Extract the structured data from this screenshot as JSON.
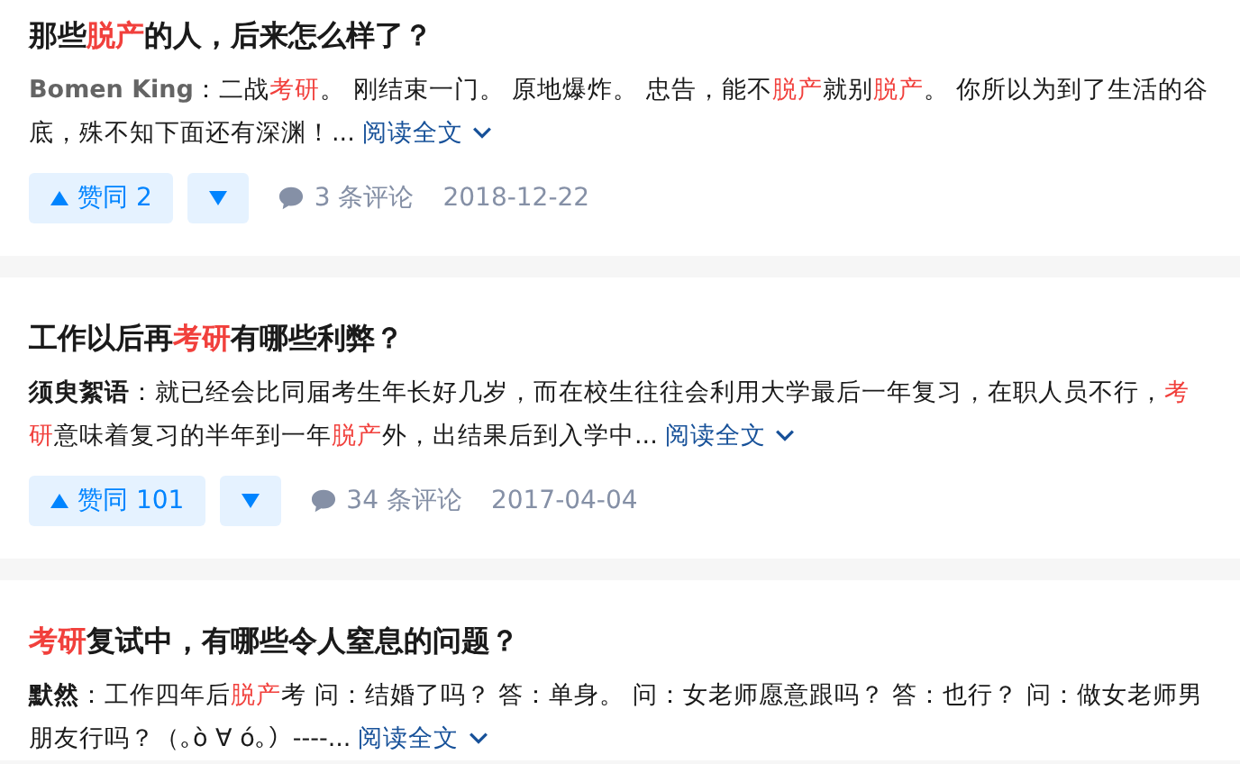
{
  "cards": [
    {
      "title": [
        {
          "text": "那些",
          "highlight": false
        },
        {
          "text": "脱产",
          "highlight": true
        },
        {
          "text": "的人，后来怎么样了？",
          "highlight": false
        }
      ],
      "author": "Bomen King",
      "author_muted": true,
      "excerpt": [
        {
          "text": "：二战",
          "highlight": false
        },
        {
          "text": "考研",
          "highlight": true
        },
        {
          "text": "。 刚结束一门。 原地爆炸。 忠告，能不",
          "highlight": false
        },
        {
          "text": "脱产",
          "highlight": true
        },
        {
          "text": "就别",
          "highlight": false
        },
        {
          "text": "脱产",
          "highlight": true
        },
        {
          "text": "。 你所以为到了生活的谷底，殊不知下面还有深渊！...",
          "highlight": false
        }
      ],
      "read_more": "阅读全文",
      "upvote": "赞同 2",
      "comments": "3 条评论",
      "date": "2018-12-22"
    },
    {
      "title": [
        {
          "text": "工作以后再",
          "highlight": false
        },
        {
          "text": "考研",
          "highlight": true
        },
        {
          "text": "有哪些利弊？",
          "highlight": false
        }
      ],
      "author": "须臾絮语",
      "author_muted": false,
      "excerpt": [
        {
          "text": "：就已经会比同届考生年长好几岁，而在校生往往会利用大学最后一年复习，在职人员不行，",
          "highlight": false
        },
        {
          "text": "考研",
          "highlight": true
        },
        {
          "text": "意味着复习的半年到一年",
          "highlight": false
        },
        {
          "text": "脱产",
          "highlight": true
        },
        {
          "text": "外，出结果后到入学中...",
          "highlight": false
        }
      ],
      "read_more": "阅读全文",
      "upvote": "赞同 101",
      "comments": "34 条评论",
      "date": "2017-04-04"
    },
    {
      "title": [
        {
          "text": "考研",
          "highlight": true
        },
        {
          "text": "复试中，有哪些令人窒息的问题？",
          "highlight": false
        }
      ],
      "author": "默然",
      "author_muted": false,
      "excerpt": [
        {
          "text": "：工作四年后",
          "highlight": false
        },
        {
          "text": "脱产",
          "highlight": true
        },
        {
          "text": "考 问：结婚了吗？ 答：单身。 问：女老师愿意跟吗？ 答：也行？ 问：做女老师男朋友行吗？（｡ò ∀ ó｡）----...",
          "highlight": false
        }
      ],
      "read_more": "阅读全文"
    }
  ]
}
